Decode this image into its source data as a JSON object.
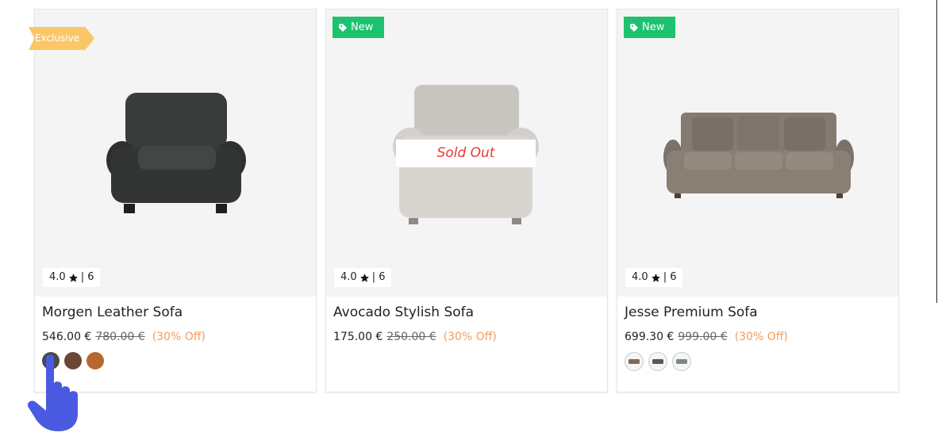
{
  "products": [
    {
      "badge": "Exclusive",
      "rating": "4.0",
      "reviews_sep": "| 6",
      "title": "Morgen Leather Sofa",
      "price": "546.00 €",
      "old_price": "780.00 €",
      "discount": "(30% Off)",
      "swatches": [
        "#4a4a4a",
        "#6b4634",
        "#b6682f"
      ]
    },
    {
      "badge": "New",
      "status": "Sold Out",
      "rating": "4.0",
      "reviews_sep": "| 6",
      "title": "Avocado Stylish Sofa",
      "price": "175.00 €",
      "old_price": "250.00 €",
      "discount": "(30% Off)"
    },
    {
      "badge": "New",
      "rating": "4.0",
      "reviews_sep": "| 6",
      "title": "Jesse Premium Sofa",
      "price": "699.30 €",
      "old_price": "999.00 €",
      "discount": "(30% Off)"
    }
  ],
  "colors": {
    "exclusive": "#fbc766",
    "new": "#1cc26e",
    "sold_out_text": "#e53a32",
    "discount": "#f39b5e",
    "hand": "#4a5ae0"
  }
}
